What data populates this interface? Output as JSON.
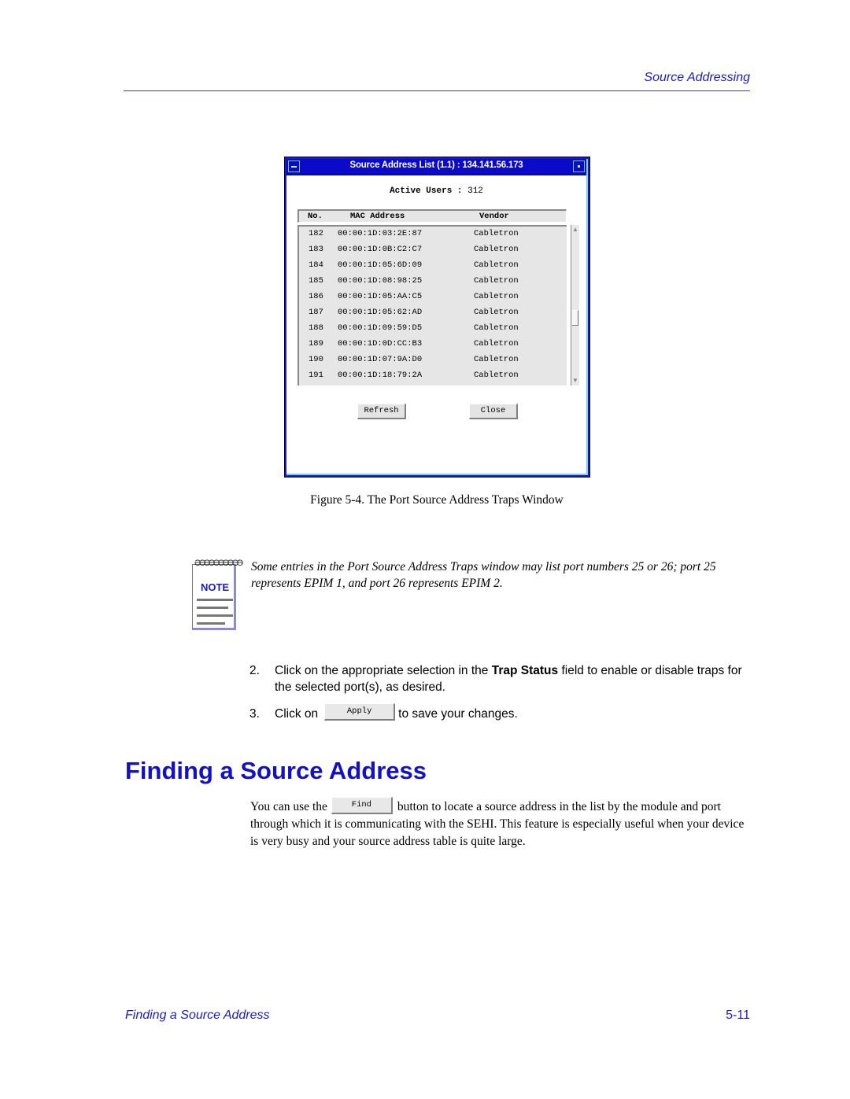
{
  "header": {
    "running_title": "Source Addressing"
  },
  "figure": {
    "window": {
      "title": "Source Address List (1.1) : 134.141.56.173",
      "active_users_label": "Active Users :",
      "active_users_value": "312",
      "columns": [
        "No.",
        "MAC Address",
        "Vendor"
      ],
      "rows": [
        {
          "no": "182",
          "mac": "00:00:1D:03:2E:87",
          "vendor": "Cabletron"
        },
        {
          "no": "183",
          "mac": "00:00:1D:0B:C2:C7",
          "vendor": "Cabletron"
        },
        {
          "no": "184",
          "mac": "00:00:1D:05:6D:09",
          "vendor": "Cabletron"
        },
        {
          "no": "185",
          "mac": "00:00:1D:08:98:25",
          "vendor": "Cabletron"
        },
        {
          "no": "186",
          "mac": "00:00:1D:05:AA:C5",
          "vendor": "Cabletron"
        },
        {
          "no": "187",
          "mac": "00:00:1D:05:62:AD",
          "vendor": "Cabletron"
        },
        {
          "no": "188",
          "mac": "00:00:1D:09:59:D5",
          "vendor": "Cabletron"
        },
        {
          "no": "189",
          "mac": "00:00:1D:0D:CC:B3",
          "vendor": "Cabletron"
        },
        {
          "no": "190",
          "mac": "00:00:1D:07:9A:D0",
          "vendor": "Cabletron"
        },
        {
          "no": "191",
          "mac": "00:00:1D:18:79:2A",
          "vendor": "Cabletron"
        }
      ],
      "buttons": {
        "refresh": "Refresh",
        "close": "Close"
      },
      "colors": {
        "titlebar": "#0a0ac8",
        "frame": "#1a1ad0"
      }
    },
    "caption": "Figure 5-4. The Port Source Address Traps Window"
  },
  "note": {
    "icon_label": "NOTE",
    "icon_rings": "ƏƏƏƏƏƏƏƏƏƏ",
    "text": "Some entries in the Port Source Address Traps window may list port numbers 25 or 26; port 25 represents EPIM 1, and port 26 represents EPIM 2."
  },
  "steps": [
    {
      "number": "2.",
      "text_before": "Click on the appropriate selection in the ",
      "bold": "Trap Status",
      "text_after": " field to enable or disable traps for the selected port(s), as desired."
    },
    {
      "number": "3.",
      "text_before": "Click on",
      "button": "Apply",
      "text_after": "to save your changes."
    }
  ],
  "section": {
    "heading": "Finding a Source Address",
    "para_before": "You can use the",
    "button": "Find",
    "para_after": "button to locate a source address in the list by the module and port through which it is communicating with the SEHI. This feature is especially useful when your device is very busy and your source address table is quite large."
  },
  "footer": {
    "left": "Finding a Source Address",
    "page": "5-11"
  },
  "colors": {
    "accent_blue": "#1a1ac8",
    "heading_blue": "#1212c0"
  }
}
